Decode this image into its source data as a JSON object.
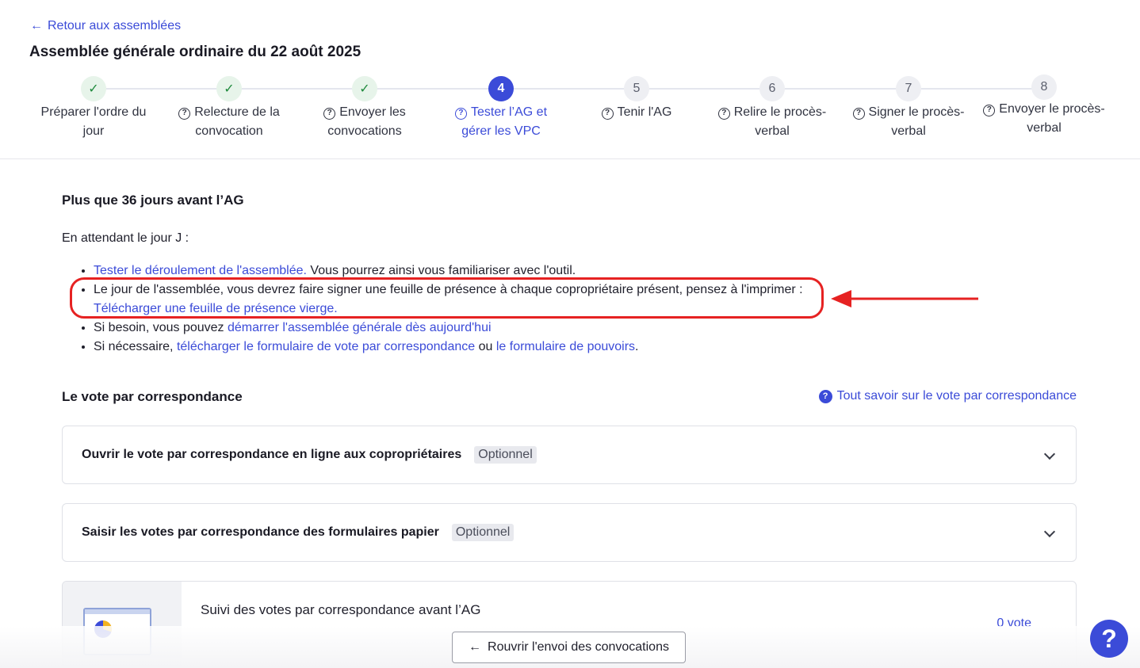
{
  "header": {
    "back_link": "Retour aux assemblées",
    "title": "Assemblée générale ordinaire du 22 août 2025"
  },
  "stepper": {
    "steps": [
      {
        "marker": "✓",
        "line1": "Préparer l'ordre du",
        "line2": "jour",
        "status": "done",
        "help": false
      },
      {
        "marker": "✓",
        "line1": "Relecture de la",
        "line2": "convocation",
        "status": "done",
        "help": true
      },
      {
        "marker": "✓",
        "line1": "Envoyer les",
        "line2": "convocations",
        "status": "done",
        "help": true
      },
      {
        "marker": "4",
        "line1": "Tester l’AG et",
        "line2": "gérer les VPC",
        "status": "active",
        "help": true
      },
      {
        "marker": "5",
        "line1": "Tenir l'AG",
        "line2": "",
        "status": "todo",
        "help": true
      },
      {
        "marker": "6",
        "line1": "Relire le procès-",
        "line2": "verbal",
        "status": "todo",
        "help": true
      },
      {
        "marker": "7",
        "line1": "Signer le procès-",
        "line2": "verbal",
        "status": "todo",
        "help": true
      },
      {
        "marker": "8",
        "line1": "Envoyer le procès-",
        "line2": "verbal",
        "status": "todo",
        "help": true
      }
    ]
  },
  "countdown": {
    "heading": "Plus que 36 jours avant l’AG",
    "intro": "En attendant le jour J :",
    "item1_link": "Tester le déroulement de l'assemblée.",
    "item1_text": " Vous pourrez ainsi vous familiariser avec l'outil.",
    "item2_text": "Le jour de l'assemblée, vous devrez faire signer une feuille de présence à chaque copropriétaire présent, pensez à l'imprimer :",
    "item2_link": "Télécharger une feuille de présence vierge.",
    "item3_text": "Si besoin, vous pouvez ",
    "item3_link": "démarrer l'assemblée générale dès aujourd'hui",
    "item4_text": "Si nécessaire, ",
    "item4_link1": "télécharger le formulaire de vote par correspondance",
    "item4_mid": " ou ",
    "item4_link2": "le formulaire de pouvoirs",
    "item4_end": "."
  },
  "vote": {
    "heading": "Le vote par correspondance",
    "info_link": "Tout savoir sur le vote par correspondance",
    "accordion1_title": "Ouvrir le vote par correspondance en ligne aux copropriétaires",
    "accordion1_badge": "Optionnel",
    "accordion2_title": "Saisir les votes par correspondance des formulaires papier",
    "accordion2_badge": "Optionnel",
    "tracking_title": "Suivi des votes par correspondance avant l’AG",
    "tracking_count": "0 vote"
  },
  "footer": {
    "reopen_button": "Rouvrir l'envoi des convocations",
    "help_fab": "?"
  },
  "colors": {
    "accent": "#3b4bd8",
    "done_green": "#1f8a3d",
    "annotation_red": "#e62222"
  }
}
